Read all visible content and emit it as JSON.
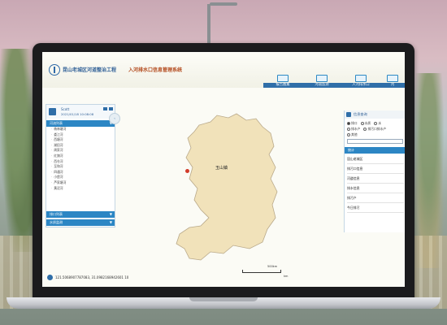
{
  "header": {
    "title_main": "昆山老城区河道整治工程",
    "title_sub": "入河排水口信息管理系统"
  },
  "nav": {
    "tabs": [
      {
        "label": "报告图集"
      },
      {
        "label": "河道监测"
      },
      {
        "label": "入河排水口"
      },
      {
        "label": "河"
      }
    ]
  },
  "user": {
    "name": "Scott",
    "datetime": "2021/01/18 10:08:08"
  },
  "left_panel": {
    "section_title": "河流列表",
    "rivers": [
      "杨林塘河",
      "娄江河",
      "西塘河",
      "湖田河",
      "周家河",
      "红旗河",
      "西仓河",
      "至和河",
      "四通河",
      "小虞河",
      "芦家塘河",
      "黄泥河"
    ],
    "section2_title": "排口列表",
    "section3_title": "水质监测"
  },
  "map": {
    "place_label": "玉山镇",
    "scale_top": "500km",
    "scale_bottom": "km",
    "coordinates": "121.5068907787083, 31.0982168942601 10"
  },
  "right_panel": {
    "title": "信息查询",
    "radio_row1": [
      "排口",
      "水质",
      "水"
    ],
    "radio_row2": [
      "排水户",
      "排污口排水户"
    ],
    "radio_row3": [
      "其他"
    ],
    "list_head": "统计",
    "items": [
      "昆山老城区",
      "排污口信息",
      "河道信息",
      "排水信息",
      "排污户",
      "今日排污"
    ]
  }
}
